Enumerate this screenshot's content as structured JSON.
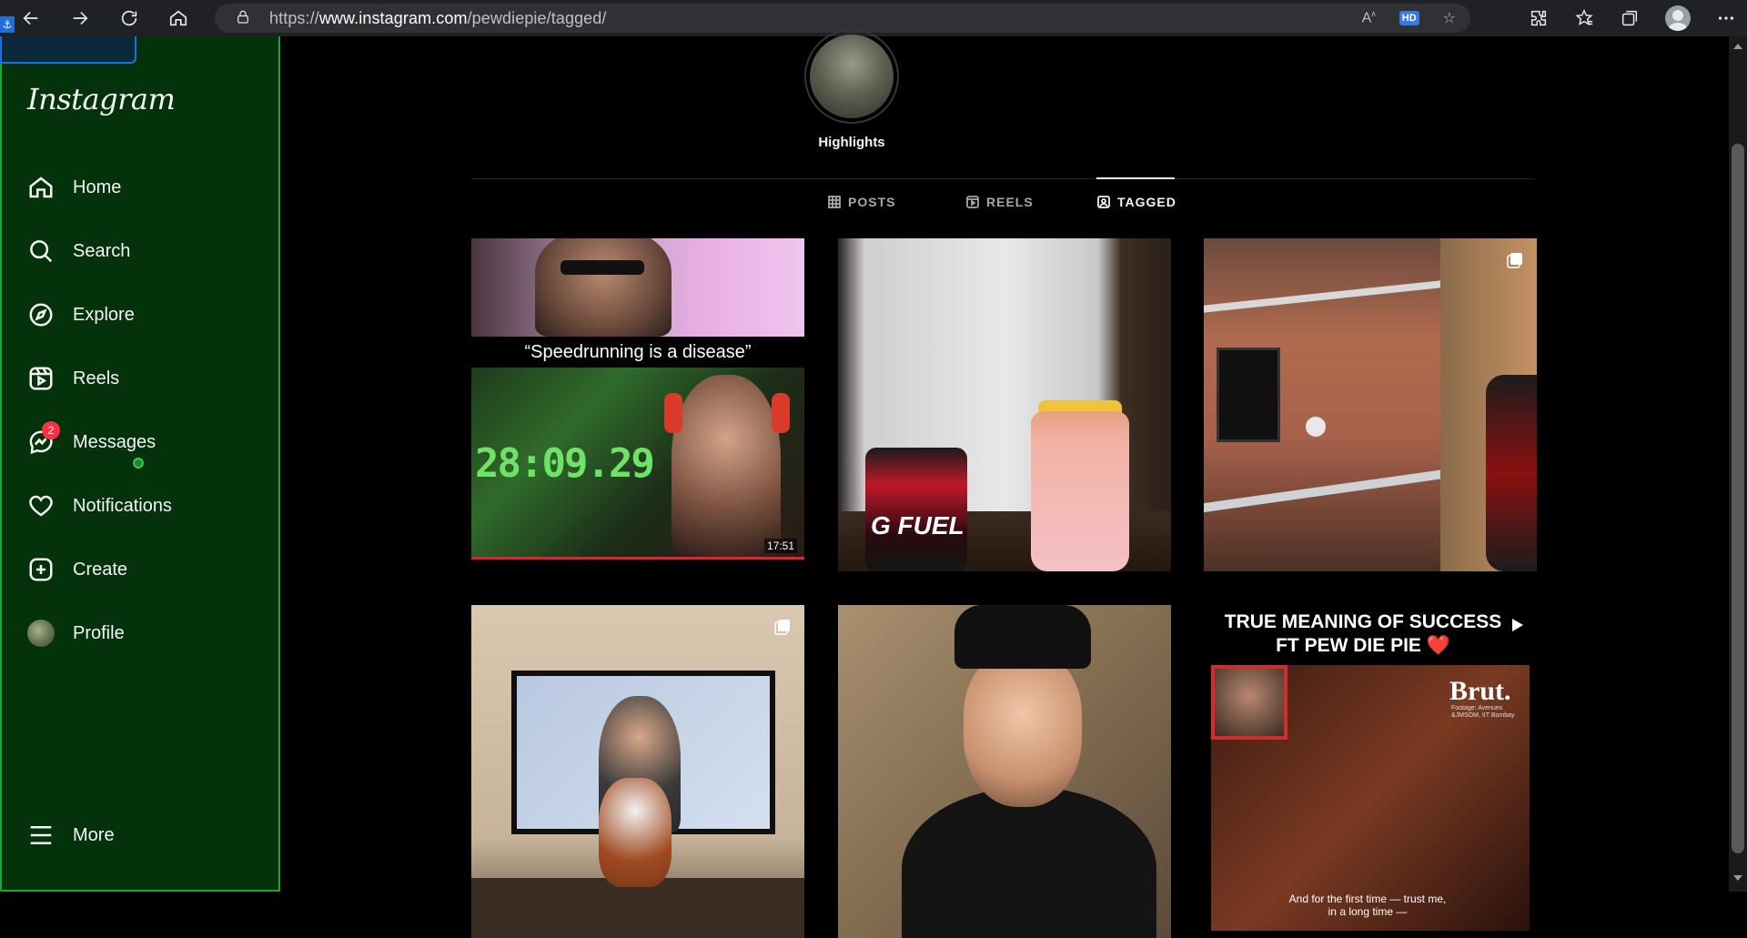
{
  "browser": {
    "url_prefix": "https://",
    "url_host": "www.instagram.com",
    "url_path": "/pewdiepie/tagged/",
    "read_aloud_label": "A̩",
    "hd_label": "HD"
  },
  "sidebar": {
    "logo": "Instagram",
    "items": [
      {
        "label": "Home",
        "icon": "home-icon"
      },
      {
        "label": "Search",
        "icon": "search-icon"
      },
      {
        "label": "Explore",
        "icon": "compass-icon"
      },
      {
        "label": "Reels",
        "icon": "reels-icon"
      },
      {
        "label": "Messages",
        "icon": "messenger-icon",
        "badge": "2"
      },
      {
        "label": "Notifications",
        "icon": "heart-icon"
      },
      {
        "label": "Create",
        "icon": "plus-square-icon"
      },
      {
        "label": "Profile",
        "icon": "profile-avatar"
      }
    ],
    "more_label": "More",
    "accent_color": "#1fa236"
  },
  "profile": {
    "highlight_label": "Highlights"
  },
  "tabs": [
    {
      "label": "POSTS",
      "icon": "grid-icon",
      "active": false
    },
    {
      "label": "REELS",
      "icon": "reels-icon",
      "active": false
    },
    {
      "label": "TAGGED",
      "icon": "tag-icon",
      "active": true
    }
  ],
  "posts": [
    {
      "caption": "“Speedrunning is a disease”",
      "timer": "28:09.29",
      "duration": "17:51",
      "type": "video"
    },
    {
      "can_text": "G FUEL",
      "type": "image"
    },
    {
      "type": "carousel"
    },
    {
      "type": "carousel"
    },
    {
      "type": "image"
    },
    {
      "title": "TRUE MEANING OF SUCCESS FT PEW DIE PIE ❤️",
      "brand": "Brut.",
      "brand_sub": "Footage: Avenues &JMSOM, IIT Bombay",
      "subtitle": "And for the first time — trust me, in a long time —",
      "type": "reel"
    }
  ],
  "colors": {
    "background": "#000000",
    "sidebar_bg": "#04320a",
    "badge": "#ff3040"
  }
}
